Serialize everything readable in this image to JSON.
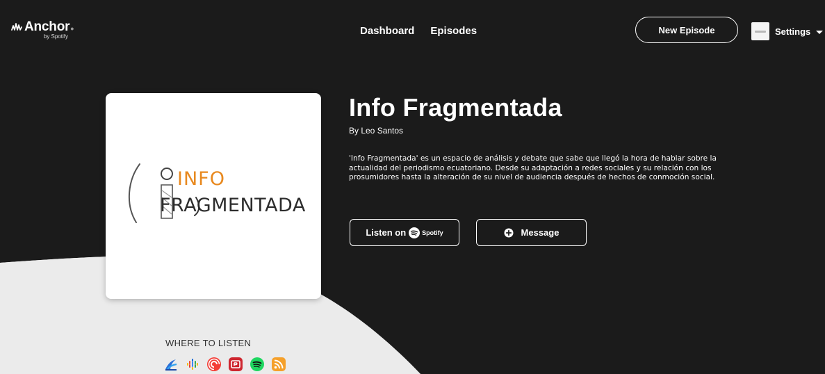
{
  "nav": {
    "logo_text": "Anchor",
    "logo_sub": "by Spotify",
    "links": [
      {
        "label": "Dashboard"
      },
      {
        "label": "Episodes"
      }
    ],
    "new_episode_label": "New Episode",
    "settings_label": "Settings"
  },
  "cover": {
    "word_top": "INFO",
    "word_bottom": "FRAGMENTADA"
  },
  "podcast": {
    "title": "Info Fragmentada",
    "author": "By Leo Santos",
    "description": "'Info Fragmentada' es un espacio de análisis y debate que sabe que llegó la hora de hablar sobre la actualidad del periodismo ecuatoriano. Desde su adaptación a redes sociales y su relación con los prosumidores hasta la alteración de su nivel de audiencia después de hechos de conmoción social.",
    "listen_label": "Listen on",
    "spotify_word": "Spotify",
    "message_label": "Message"
  },
  "where_to_listen": {
    "title": "WHERE TO LISTEN",
    "platforms": [
      {
        "icon": "breaker-icon",
        "color": "#ffffff"
      },
      {
        "icon": "google-podcasts-icon",
        "color": "#ffffff"
      },
      {
        "icon": "pocket-casts-icon",
        "color": "#f43e37"
      },
      {
        "icon": "radiopublic-icon",
        "color": "#ce262f"
      },
      {
        "icon": "spotify-icon",
        "color": "#1ed760"
      },
      {
        "icon": "rss-icon",
        "color": "#f5a02a"
      }
    ]
  },
  "colors": {
    "background_dark": "#1b1b1b",
    "background_light": "#ebebeb",
    "cover_orange": "#e8891f"
  }
}
